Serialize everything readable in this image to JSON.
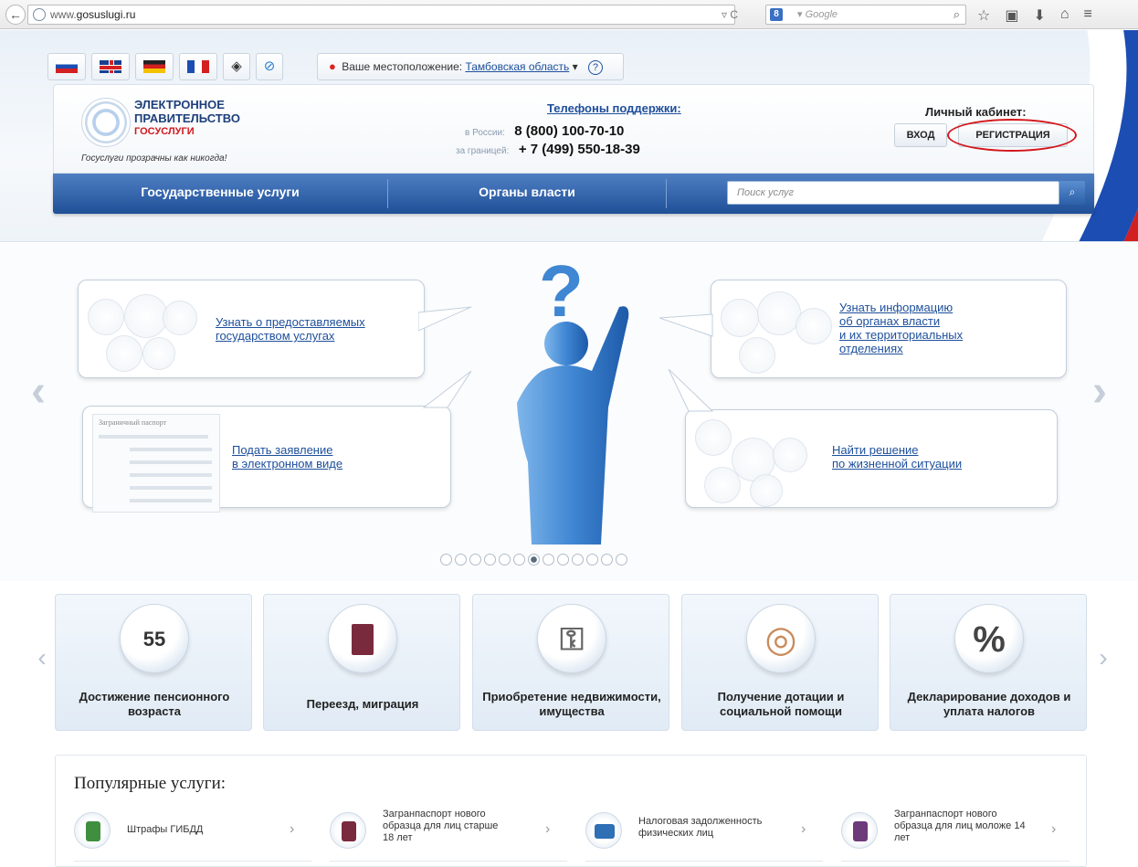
{
  "browser": {
    "back": "←",
    "url_prefix": "www.",
    "url_domain": "gosuslugi.ru",
    "url_tools": "▿ C",
    "search_engine_icon": "8",
    "search_placeholder": "▾ Google",
    "search_mag": "⌕",
    "icons": [
      "☆",
      "▣",
      "⬇",
      "⌂",
      "≡"
    ]
  },
  "header": {
    "location_label": "Ваше местоположение:",
    "location_value": "Тамбовская область",
    "location_help": "?",
    "logo_line1": "ЭЛЕКТРОННОЕ",
    "logo_line2": "ПРАВИТЕЛЬСТВО",
    "logo_sub": "ГОСУСЛУГИ",
    "logo_tagline": "Госуслуги прозрачны как никогда!",
    "support_title": "Телефоны поддержки",
    "phone_ru_label": "в России:",
    "phone_ru": "8 (800) 100-70-10",
    "phone_abroad_label": "за границей:",
    "phone_abroad": "+ 7 (499) 550-18-39",
    "cabinet_title": "Личный кабинет:",
    "login_label": "ВХОД",
    "register_label": "РЕГИСТРАЦИЯ"
  },
  "nav": {
    "gov_services": "Государственные услуги",
    "authorities": "Органы власти",
    "search_placeholder": "Поиск услуг"
  },
  "carousel": {
    "link_services": [
      "Узнать о предоставляемых",
      "государством услугах"
    ],
    "link_authorities": [
      "Узнать информацию",
      "об органах власти",
      "и их территориальных",
      "отделениях"
    ],
    "link_apply": [
      "Подать заявление",
      "в электронном виде"
    ],
    "link_life": [
      "Найти решение",
      "по жизненной ситуации"
    ],
    "form_mock_title": "Заграничный паспорт",
    "dots_count": 13,
    "dots_active": 7,
    "prev": "‹",
    "next": "›"
  },
  "categories": [
    {
      "label": "Достижение пенсионного возраста",
      "icon": "calendar-icon",
      "glyph": "55"
    },
    {
      "label": "Переезд, миграция",
      "icon": "passport-icon",
      "glyph": ""
    },
    {
      "label": "Приобретение недвижимости, имущества",
      "icon": "keys-icon",
      "glyph": "⚿"
    },
    {
      "label": "Получение дотации и социальной помощи",
      "icon": "lifebuoy-icon",
      "glyph": "◎"
    },
    {
      "label": "Декларирование доходов и уплата налогов",
      "icon": "percent-icon",
      "glyph": "%"
    }
  ],
  "popular": {
    "title": "Популярные услуги:",
    "items": [
      {
        "label": "Штрафы ГИБДД",
        "icon": "traffic-light-icon",
        "color": "#3f8f3f"
      },
      {
        "label": "Загранпаспорт нового образца для лиц старше 18 лет",
        "icon": "passport-icon",
        "color": "#7a2a3d"
      },
      {
        "label": "Налоговая задолженность физических лиц",
        "icon": "tax-icon",
        "color": "#2e6fb5"
      },
      {
        "label": "Загранпаспорт нового образца для лиц моложе 14 лет",
        "icon": "passport-icon",
        "color": "#6d3a7a"
      }
    ],
    "chevron": "›"
  },
  "colors": {
    "brand_blue": "#1f4f97",
    "link_blue": "#1d4f9c",
    "accent_red": "#d3161c"
  }
}
